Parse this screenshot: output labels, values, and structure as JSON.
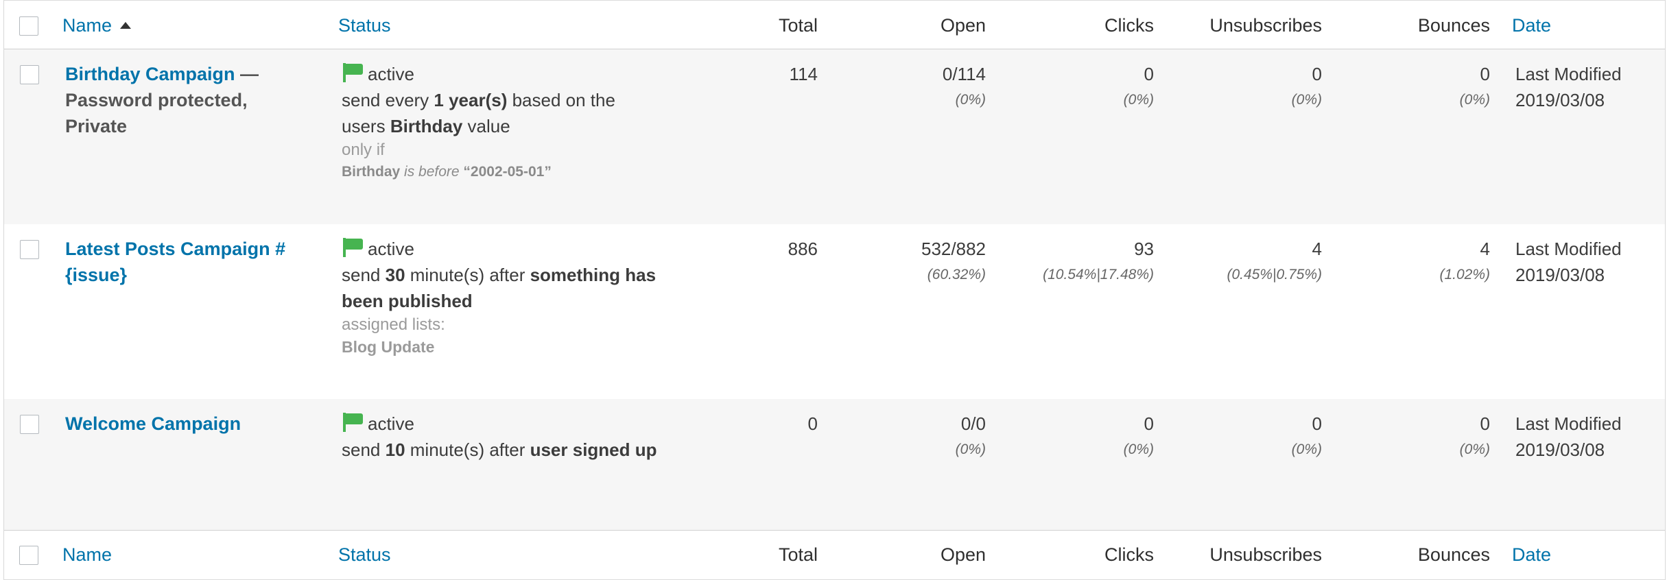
{
  "columns": {
    "name": "Name",
    "status": "Status",
    "total": "Total",
    "open": "Open",
    "clicks": "Clicks",
    "unsubscribes": "Unsubscribes",
    "bounces": "Bounces",
    "date": "Date"
  },
  "rows": [
    {
      "title": "Birthday Campaign",
      "title_suffix": " — Password protected, Private",
      "status": "active",
      "desc_pre": "send every ",
      "desc_b1": "1 year(s)",
      "desc_mid": " based on the users ",
      "desc_b2": "Birthday",
      "desc_post": " value",
      "extra_label": "only if",
      "cond_field": "Birthday",
      "cond_op": "is before",
      "cond_value": "“2002-05-01”",
      "total": "114",
      "open": "0/114",
      "open_pct": "(0%)",
      "clicks": "0",
      "clicks_pct": "(0%)",
      "unsubscribes": "0",
      "unsubscribes_pct": "(0%)",
      "bounces": "0",
      "bounces_pct": "(0%)",
      "date_label": "Last Modified",
      "date": "2019/03/08"
    },
    {
      "title": "Latest Posts Campaign #{issue}",
      "status": "active",
      "desc_pre": "send ",
      "desc_b1": "30",
      "desc_mid": " minute(s) after ",
      "desc_b2": "something has been published",
      "extra_label": "assigned lists:",
      "list_name": "Blog Update",
      "total": "886",
      "open": "532/882",
      "open_pct": "(60.32%)",
      "clicks": "93",
      "clicks_pct": "(10.54%|17.48%)",
      "unsubscribes": "4",
      "unsubscribes_pct": "(0.45%|0.75%)",
      "bounces": "4",
      "bounces_pct": "(1.02%)",
      "date_label": "Last Modified",
      "date": "2019/03/08"
    },
    {
      "title": "Welcome Campaign",
      "status": "active",
      "desc_pre": "send ",
      "desc_b1": "10",
      "desc_mid": " minute(s) after ",
      "desc_b2": "user signed up",
      "total": "0",
      "open": "0/0",
      "open_pct": "(0%)",
      "clicks": "0",
      "clicks_pct": "(0%)",
      "unsubscribes": "0",
      "unsubscribes_pct": "(0%)",
      "bounces": "0",
      "bounces_pct": "(0%)",
      "date_label": "Last Modified",
      "date": "2019/03/08"
    }
  ]
}
